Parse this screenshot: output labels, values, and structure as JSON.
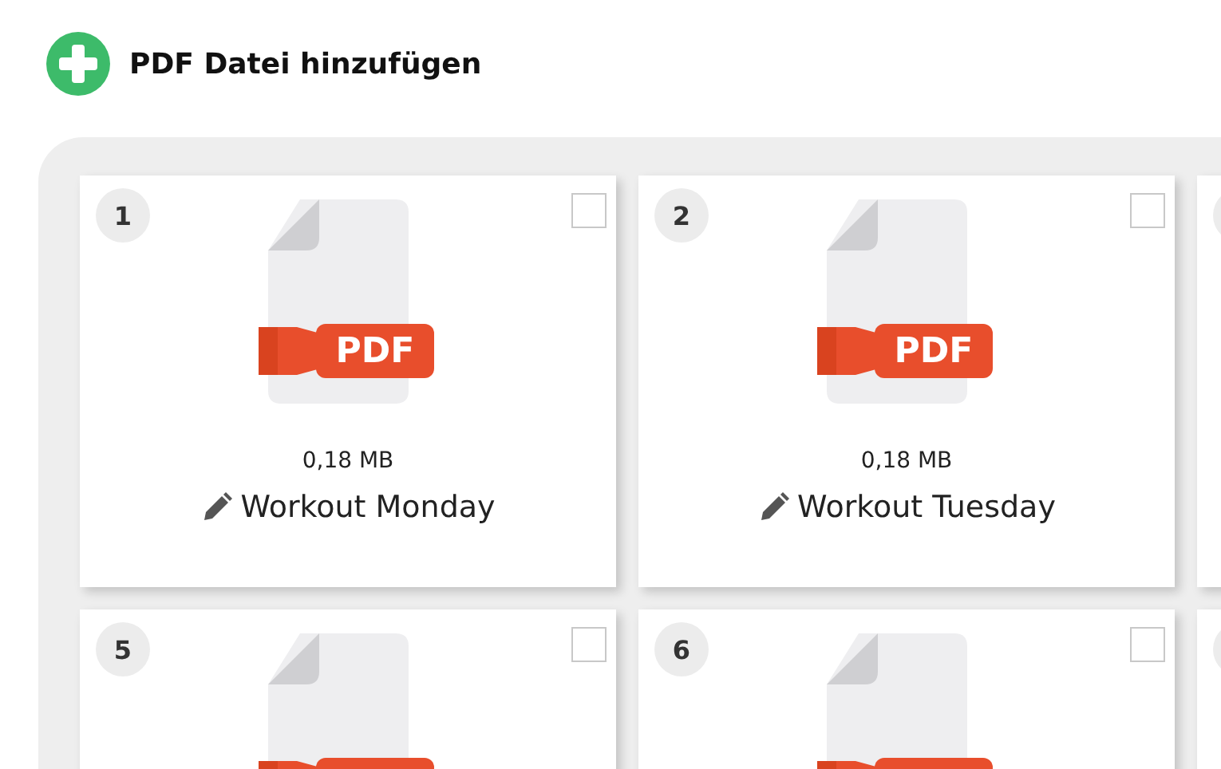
{
  "header": {
    "label": "PDF Datei hinzufügen"
  },
  "files": [
    {
      "kind": "file",
      "number": "1",
      "checked": false,
      "file_type": "PDF",
      "size": "0,18 MB",
      "name": "Workout Monday"
    },
    {
      "kind": "file",
      "number": "2",
      "checked": false,
      "file_type": "PDF",
      "size": "0,18 MB",
      "name": "Workout Tuesday"
    },
    {
      "kind": "edge"
    },
    {
      "kind": "file",
      "number": "5",
      "checked": false
    },
    {
      "kind": "file",
      "number": "6",
      "checked": false
    },
    {
      "kind": "edge"
    }
  ]
}
